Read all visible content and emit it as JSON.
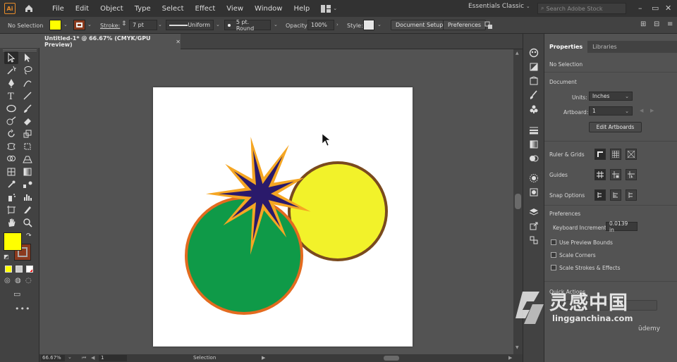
{
  "app": {
    "logo": "Ai",
    "menus": [
      "File",
      "Edit",
      "Object",
      "Type",
      "Select",
      "Effect",
      "View",
      "Window",
      "Help"
    ],
    "workspace": "Essentials Classic",
    "search_placeholder": "Search Adobe Stock"
  },
  "control": {
    "selection": "No Selection",
    "stroke_label": "Stroke:",
    "stroke_weight": "7 pt",
    "stroke_profile": "Uniform",
    "brush": "5 pt. Round",
    "opacity_label": "Opacity:",
    "opacity": "100%",
    "style_label": "Style:",
    "document_setup": "Document Setup",
    "preferences": "Preferences"
  },
  "document": {
    "tab_title": "Untitled-1* @ 66.67% (CMYK/GPU Preview)"
  },
  "status": {
    "zoom": "66.67%",
    "artboard": "1",
    "tool": "Selection"
  },
  "properties": {
    "tabs": [
      "Properties",
      "Libraries"
    ],
    "selection": "No Selection",
    "document_title": "Document",
    "units_label": "Units:",
    "units": "Inches",
    "artboard_label": "Artboard:",
    "artboard": "1",
    "edit_artboards": "Edit Artboards",
    "ruler_grids": "Ruler & Grids",
    "guides": "Guides",
    "snap_options": "Snap Options",
    "preferences_title": "Preferences",
    "keyboard_increment_label": "Keyboard Increment:",
    "keyboard_increment": "0.0139 in",
    "use_preview_bounds": "Use Preview Bounds",
    "scale_corners": "Scale Corners",
    "scale_strokes": "Scale Strokes & Effects",
    "quick_actions": "Quick Actions"
  },
  "watermark": {
    "main": "灵感中国",
    "sub": "lingganchina.com",
    "corner": "ūdemy"
  },
  "colors": {
    "fill": "#ffff00",
    "stroke": "#8b3a1e",
    "green": "#0f9a48",
    "green_stroke": "#e36b1f",
    "yellow": "#f2f22a",
    "yellow_stroke": "#7a4a1e",
    "star_outer": "#f5a623",
    "star_inner": "#2a1a6b"
  }
}
